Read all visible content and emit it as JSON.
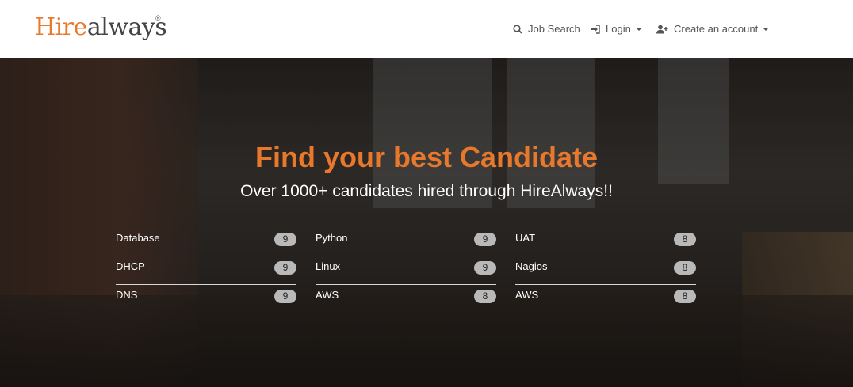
{
  "brand": {
    "part1": "Hire",
    "part2": "always",
    "registered": "®"
  },
  "nav": {
    "job_search": {
      "label": "Job Search",
      "icon": "search-icon"
    },
    "login": {
      "label": "Login",
      "icon": "sign-in-icon"
    },
    "create_account": {
      "label": "Create an account",
      "icon": "user-plus-icon"
    }
  },
  "hero": {
    "title": "Find your best Candidate",
    "subtitle": "Over 1000+ candidates hired through HireAlways!!"
  },
  "skill_columns": [
    [
      {
        "name": "Database",
        "count": "9"
      },
      {
        "name": "DHCP",
        "count": "9"
      },
      {
        "name": "DNS",
        "count": "9"
      }
    ],
    [
      {
        "name": "Python",
        "count": "9"
      },
      {
        "name": "Linux",
        "count": "9"
      },
      {
        "name": "AWS",
        "count": "8"
      }
    ],
    [
      {
        "name": "UAT",
        "count": "8"
      },
      {
        "name": "Nagios",
        "count": "8"
      },
      {
        "name": "AWS",
        "count": "8"
      }
    ]
  ],
  "colors": {
    "accent": "#e8782b",
    "nav_text": "#555555",
    "badge_bg": "#b9b9b9"
  }
}
